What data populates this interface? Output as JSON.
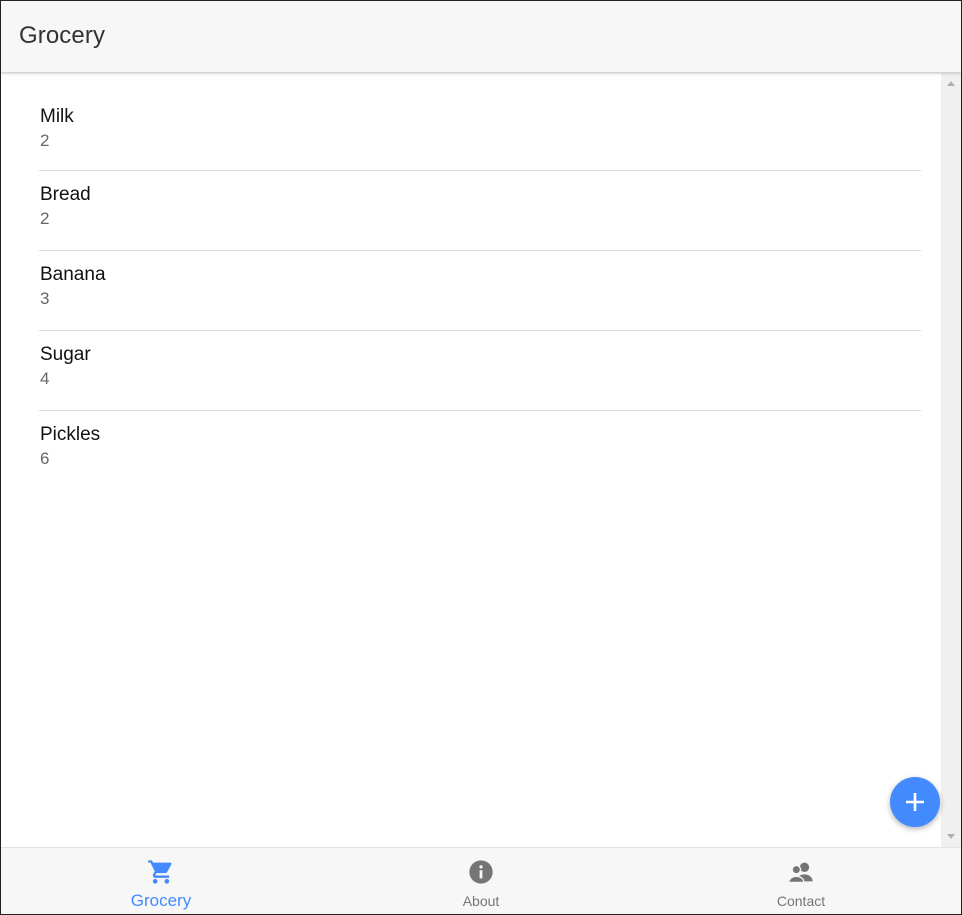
{
  "header": {
    "title": "Grocery"
  },
  "items": [
    {
      "name": "Milk",
      "qty": "2"
    },
    {
      "name": "Bread",
      "qty": "2"
    },
    {
      "name": "Banana",
      "qty": "3"
    },
    {
      "name": "Sugar",
      "qty": "4"
    },
    {
      "name": "Pickles",
      "qty": "6"
    }
  ],
  "fab": {
    "icon": "plus-icon"
  },
  "nav": {
    "tabs": [
      {
        "label": "Grocery",
        "icon": "cart-icon",
        "active": true
      },
      {
        "label": "About",
        "icon": "info-icon",
        "active": false
      },
      {
        "label": "Contact",
        "icon": "contacts-icon",
        "active": false
      }
    ]
  },
  "colors": {
    "accent": "#448aff",
    "inactive": "#757575",
    "header_bg": "#f7f7f7"
  }
}
